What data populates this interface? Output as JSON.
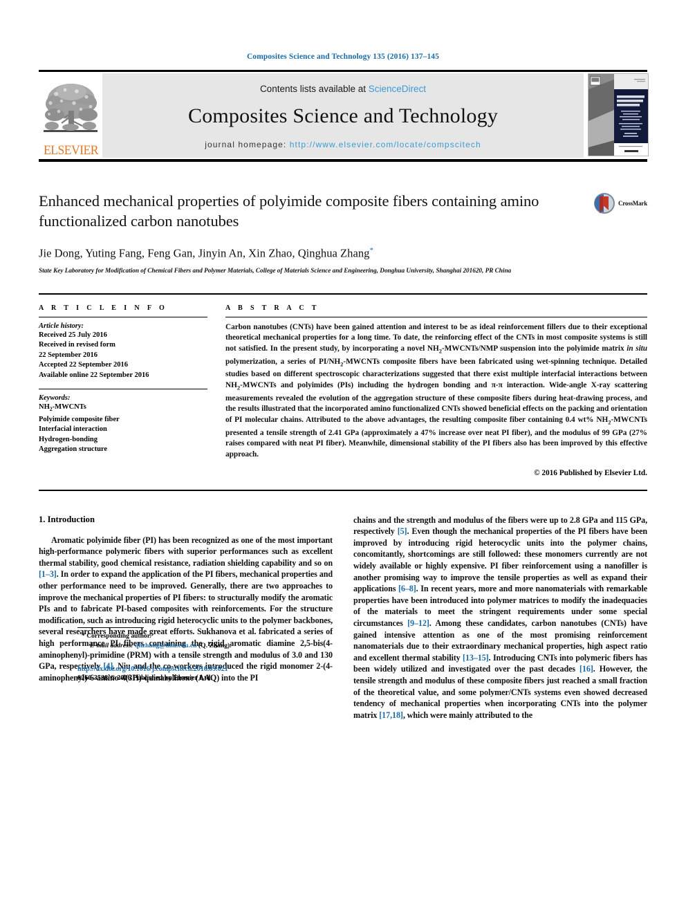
{
  "running_head": "Composites Science and Technology 135 (2016) 137–145",
  "masthead": {
    "publisher_name": "ELSEVIER",
    "contents_prefix": "Contents lists available at ",
    "contents_link": "ScienceDirect",
    "journal_name": "Composites Science and Technology",
    "homepage_prefix": "journal homepage: ",
    "homepage_url": "http://www.elsevier.com/locate/compscitech",
    "cover_title_lines": [
      "COMPOSITES",
      "SCIENCE AND",
      "TECHNOLOGY"
    ],
    "cover_footer": "ELSEVIER"
  },
  "article": {
    "title": "Enhanced mechanical properties of polyimide composite fibers containing amino functionalized carbon nanotubes",
    "authors": "Jie Dong, Yuting Fang, Feng Gan, Jinyin An, Xin Zhao, Qinghua Zhang",
    "corresponding_marker": "*",
    "affiliation": "State Key Laboratory for Modification of Chemical Fibers and Polymer Materials, College of Materials Science and Engineering, Donghua University, Shanghai 201620, PR China",
    "crossmark_label": "CrossMark"
  },
  "article_info": {
    "heading": "A R T I C L E  I N F O",
    "history_label": "Article history:",
    "history": [
      "Received 25 July 2016",
      "Received in revised form",
      "22 September 2016",
      "Accepted 22 September 2016",
      "Available online 22 September 2016"
    ],
    "keywords_label": "Keywords:",
    "keywords": [
      "NH2-MWCNTs",
      "Polyimide composite fiber",
      "Interfacial interaction",
      "Hydrogen-bonding",
      "Aggregation structure"
    ]
  },
  "abstract": {
    "heading": "A B S T R A C T",
    "text": "Carbon nanotubes (CNTs) have been gained attention and interest to be as ideal reinforcement fillers due to their exceptional theoretical mechanical properties for a long time. To date, the reinforcing effect of the CNTs in most composite systems is still not satisfied. In the present study, by incorporating a novel NH2-MWCNTs/NMP suspension into the polyimide matrix in situ polymerization, a series of PI/NH2-MWCNTs composite fibers have been fabricated using wet-spinning technique. Detailed studies based on different spectroscopic characterizations suggested that there exist multiple interfacial interactions between NH2-MWCNTs and polyimides (PIs) including the hydrogen bonding and π-π interaction. Wide-angle X-ray scattering measurements revealed the evolution of the aggregation structure of these composite fibers during heat-drawing process, and the results illustrated that the incorporated amino functionalized CNTs showed beneficial effects on the packing and orientation of PI molecular chains. Attributed to the above advantages, the resulting composite fiber containing 0.4 wt% NH2-MWCNTs presented a tensile strength of 2.41 GPa (approximately a 47% increase over neat PI fiber), and the modulus of 99 GPa (27% raises compared with neat PI fiber). Meanwhile, dimensional stability of the PI fibers also has been improved by this effective approach.",
    "copyright": "© 2016 Published by Elsevier Ltd."
  },
  "body": {
    "section_number_title": "1.  Introduction",
    "left_paragraph": "Aromatic polyimide fiber (PI) has been recognized as one of the most important high-performance polymeric fibers with superior performances such as excellent thermal stability, good chemical resistance, radiation shielding capability and so on [1–3]. In order to expand the application of the PI fibers, mechanical properties and other performance need to be improved. Generally, there are two approaches to improve the mechanical properties of PI fibers: to structurally modify the aromatic PIs and to fabricate PI-based composites with reinforcements. For the structure modification, such as introducing rigid heterocyclic units to the polymer backbones, several researchers have made great efforts. Sukhanova et al. fabricated a series of high performance PI fibers containing the rigid aromatic diamine 2,5-bis(4-aminophenyl)-primidine (PRM) with a tensile strength and modulus of 3.0 and 130 GPa, respectively [4]. Niu and the co-workers introduced the rigid monomer 2-(4-aminophenyl)-6-amino-4(3H)-quinazolinone (AAQ) into the PI",
    "right_paragraph": "chains and the strength and modulus of the fibers were up to 2.8 GPa and 115 GPa, respectively [5]. Even though the mechanical properties of the PI fibers have been improved by introducing rigid heterocyclic units into the polymer chains, concomitantly, shortcomings are still followed: these monomers currently are not widely available or highly expensive. PI fiber reinforcement using a nanofiller is another promising way to improve the tensile properties as well as expand their applications [6–8]. In recent years, more and more nanomaterials with remarkable properties have been introduced into polymer matrices to modify the inadequacies of the materials to meet the stringent requirements under some special circumstances [9–12]. Among these candidates, carbon nanotubes (CNTs) have gained intensive attention as one of the most promising reinforcement nanomaterials due to their extraordinary mechanical properties, high aspect ratio and excellent thermal stability [13–15]. Introducing CNTs into polymeric fibers has been widely utilized and investigated over the past decades [16]. However, the tensile strength and modulus of these composite fibers just reached a small fraction of the theoretical value, and some polymer/CNTs systems even showed decreased tendency of mechanical properties when incorporating CNTs into the polymer matrix [17,18], which were mainly attributed to the"
  },
  "footer": {
    "corresponding_marker": "*",
    "corresponding_label": "Corresponding author.",
    "email_label": "E-mail address:",
    "email": "qhzhang@dhu.edu.cn",
    "email_owner": "(Q. Zhang).",
    "doi_url": "http://dx.doi.org/10.1016/j.compscitech.2016.09.021",
    "issn_line": "0266-3538/© 2016 Published by Elsevier Ltd."
  },
  "colors": {
    "link_blue": "#1a6ba8",
    "sd_blue": "#3a9bd4",
    "elsevier_orange": "#E87722",
    "masthead_gray": "#e6e6e6"
  }
}
